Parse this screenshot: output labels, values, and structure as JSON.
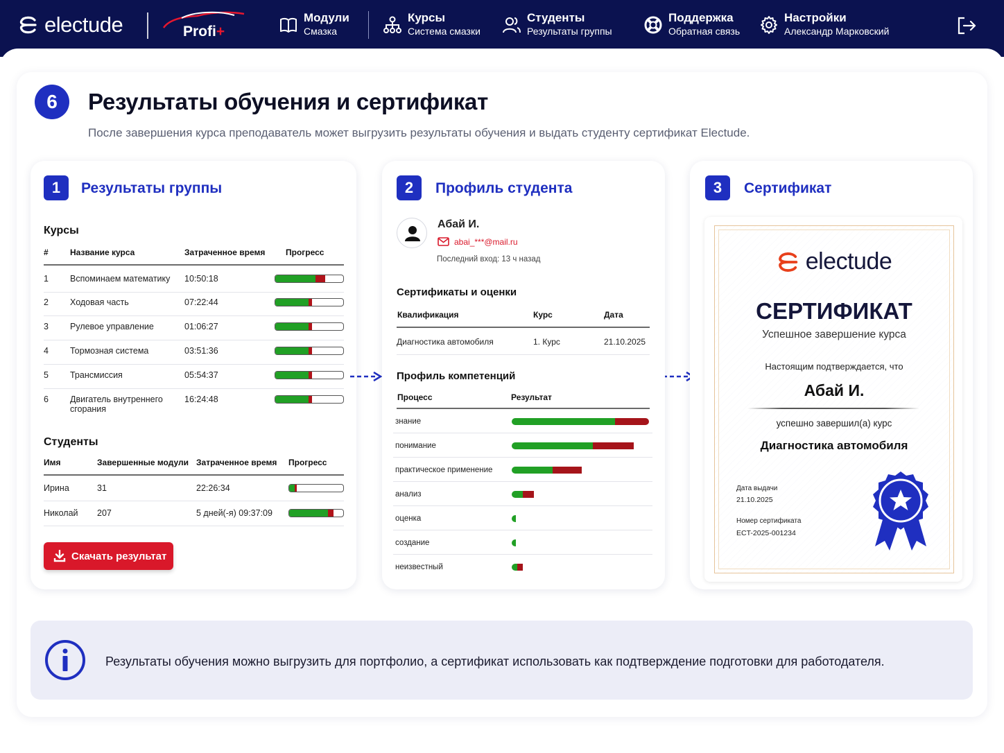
{
  "header": {
    "brand": "electude",
    "profi": "Profi",
    "profi_plus": "+",
    "nav": [
      {
        "title": "Модули",
        "sub": "Смазка"
      },
      {
        "title": "Курсы",
        "sub": "Система смазки"
      },
      {
        "title": "Студенты",
        "sub": "Результаты группы"
      },
      {
        "title": "Поддержка",
        "sub": "Обратная связь"
      },
      {
        "title": "Настройки",
        "sub": "Александр Марковский"
      }
    ]
  },
  "page": {
    "step": "6",
    "title": "Результаты обучения и сертификат",
    "subtitle": "После завершения курса преподаватель может выгрузить результаты обучения и выдать студенту сертификат Electude."
  },
  "panel1": {
    "badge": "1",
    "title": "Результаты группы",
    "courses_title": "Курсы",
    "courses_headers": [
      "#",
      "Название курса",
      "Затраченное время",
      "Прогресс"
    ],
    "courses": [
      {
        "n": "1",
        "name": "Вспоминаем математику",
        "time": "10:50:18",
        "green": 0.58,
        "red": 0.14
      },
      {
        "n": "2",
        "name": "Ходовая часть",
        "time": "07:22:44",
        "green": 0.48,
        "red": 0.05
      },
      {
        "n": "3",
        "name": "Рулевое управление",
        "time": "01:06:27",
        "green": 0.48,
        "red": 0.05
      },
      {
        "n": "4",
        "name": "Тормозная система",
        "time": "03:51:36",
        "green": 0.48,
        "red": 0.05
      },
      {
        "n": "5",
        "name": "Трансмиссия",
        "time": "05:54:37",
        "green": 0.48,
        "red": 0.05
      },
      {
        "n": "6",
        "name": "Двигатель внутреннего сгорания",
        "time": "16:24:48",
        "green": 0.48,
        "red": 0.05
      }
    ],
    "students_title": "Студенты",
    "students_headers": [
      "Имя",
      "Завершенные модули",
      "Затраченное время",
      "Прогресс"
    ],
    "students": [
      {
        "name": "Ирина",
        "modules": "31",
        "time": "22:26:34",
        "green": 0.1,
        "red": 0.04
      },
      {
        "name": "Николай",
        "modules": "207",
        "time": "5 дней(-я) 09:37:09",
        "green": 0.7,
        "red": 0.1
      }
    ],
    "download_label": "Скачать результат"
  },
  "panel2": {
    "badge": "2",
    "title": "Профиль студента",
    "student_name": "Абай И.",
    "email": "abai_***@mail.ru",
    "last_login": "Последний вход: 13 ч назад",
    "certs_title": "Сертификаты и оценки",
    "certs_headers": [
      "Квалификация",
      "Курс",
      "Дата"
    ],
    "certs": [
      {
        "qual": "Диагностика автомобиля",
        "course": "1. Курс",
        "date": "21.10.2025"
      }
    ],
    "comp_title": "Профиль компетенций",
    "comp_headers": [
      "Процесс",
      "Результат"
    ],
    "competencies": [
      {
        "name": "знание",
        "green": 0.75,
        "red": 0.25
      },
      {
        "name": "понимание",
        "green": 0.59,
        "red": 0.3
      },
      {
        "name": "практическое применение",
        "green": 0.3,
        "red": 0.21
      },
      {
        "name": "анализ",
        "green": 0.08,
        "red": 0.08
      },
      {
        "name": "оценка",
        "green": 0.03,
        "red": 0
      },
      {
        "name": "создание",
        "green": 0.03,
        "red": 0
      },
      {
        "name": "неизвестный",
        "green": 0.04,
        "red": 0.04
      }
    ]
  },
  "panel3": {
    "badge": "3",
    "title": "Сертификат",
    "cert": {
      "brand": "electude",
      "heading": "СЕРТИФИКАТ",
      "subheading": "Успешное завершение курса",
      "confirm": "Настоящим подтверждается, что",
      "name": "Абай И.",
      "completed": "успешно завершил(а) курс",
      "course": "Диагностика автомобиля",
      "issue_label": "Дата выдачи",
      "issue_date": "21.10.2025",
      "number_label": "Номер сертификата",
      "number": "ECT-2025-001234"
    }
  },
  "info": {
    "text": "Результаты обучения можно выгрузить для портфолио, а сертификат использовать как подтверждение подготовки для работодателя."
  },
  "colors": {
    "navy": "#0b1250",
    "accent": "#1f2fc0",
    "red": "#d9182a",
    "green": "#21a025",
    "dark_red": "#b0131a"
  }
}
